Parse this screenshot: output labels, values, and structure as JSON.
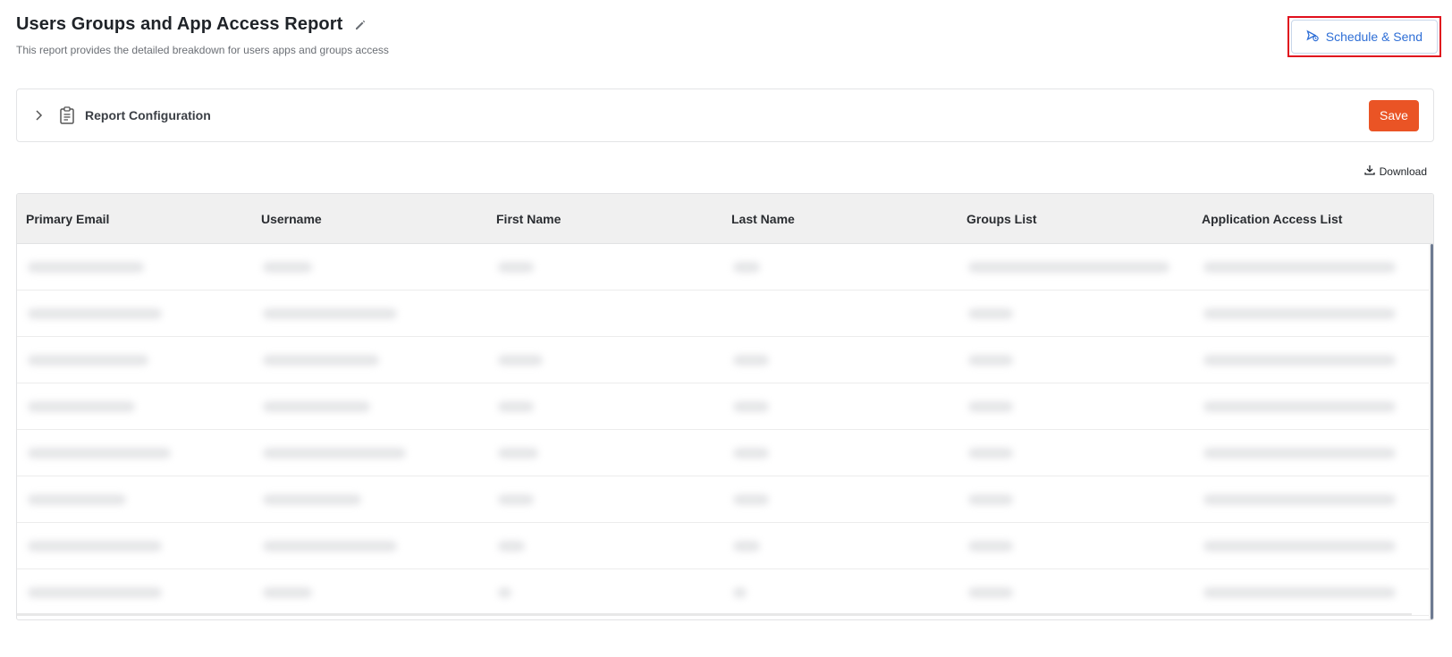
{
  "header": {
    "title": "Users Groups and App Access Report",
    "subtitle": "This report provides the detailed breakdown for users apps and groups access",
    "schedule_label": "Schedule & Send"
  },
  "config": {
    "label": "Report Configuration",
    "save_label": "Save"
  },
  "download_label": "Download",
  "table": {
    "columns": [
      "Primary Email",
      "Username",
      "First Name",
      "Last Name",
      "Groups List",
      "Application Access List"
    ]
  },
  "colors": {
    "accent": "#2f6fd6",
    "save": "#ea5425",
    "highlight": "#e0101d"
  }
}
